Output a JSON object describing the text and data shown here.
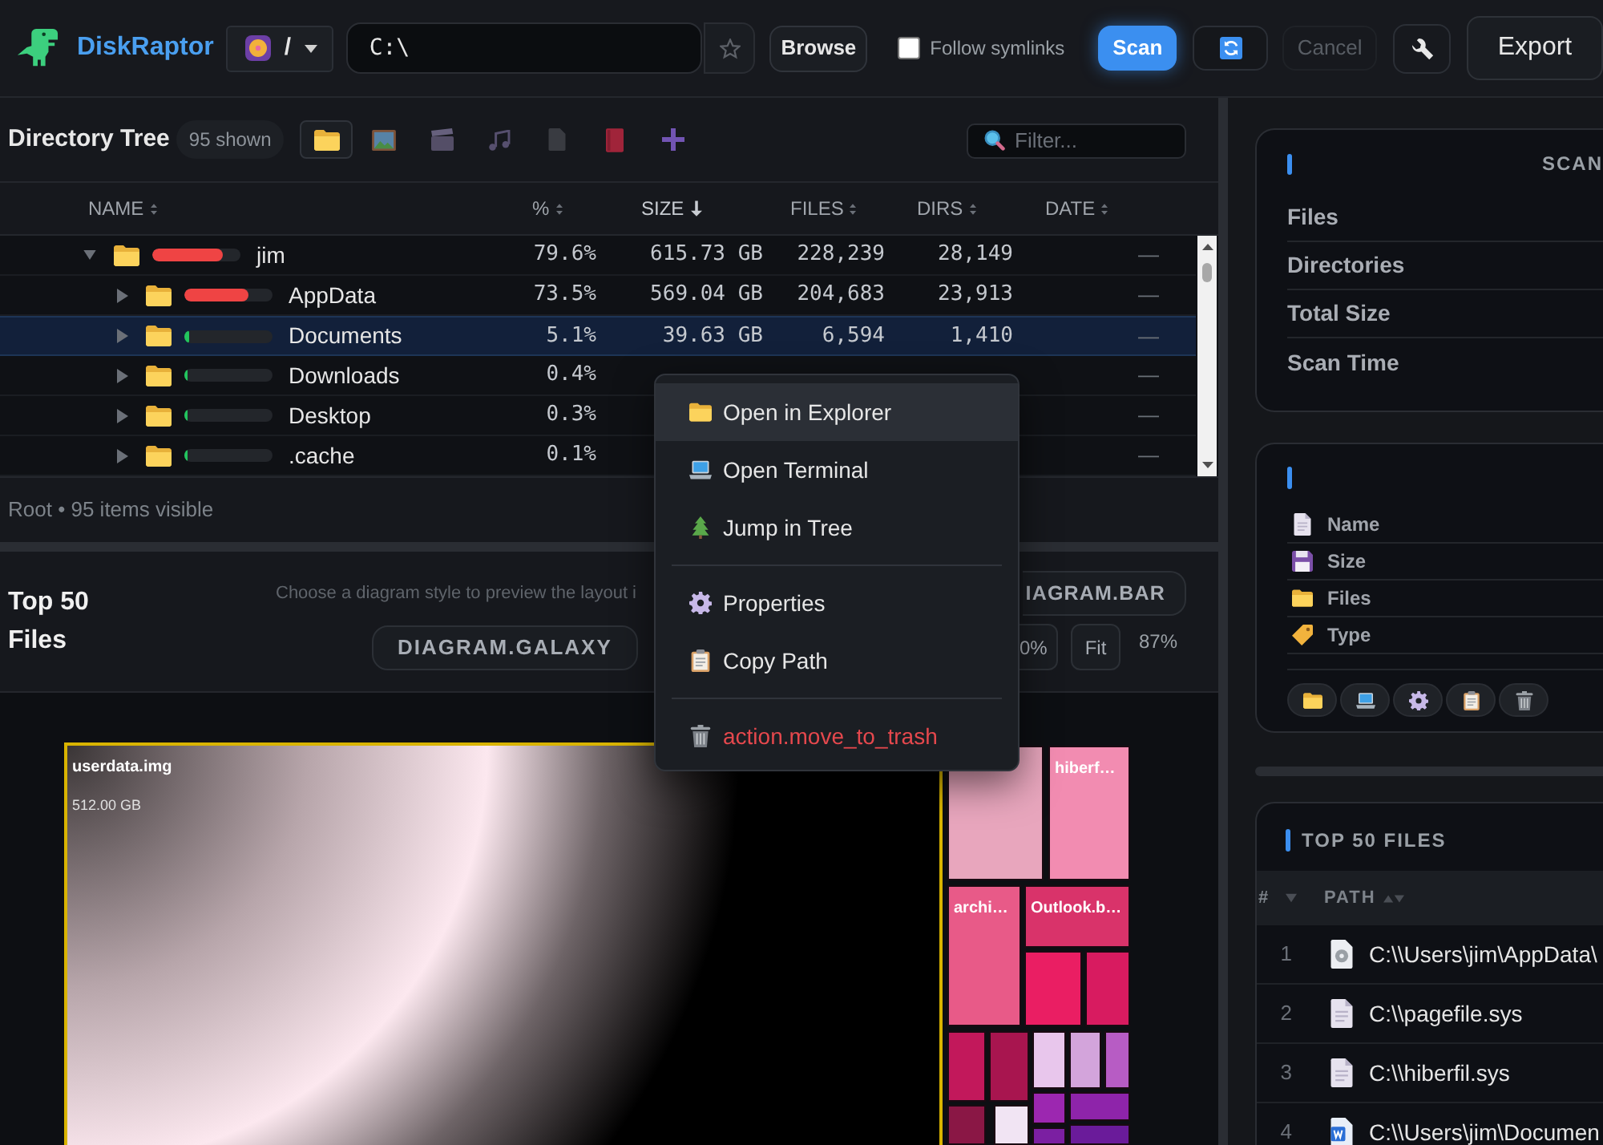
{
  "app": {
    "name": "DiskRaptor"
  },
  "toolbar": {
    "drive": {
      "label": "/"
    },
    "path": {
      "value": "C:\\"
    },
    "browse": {
      "label": "Browse"
    },
    "follow_symlinks": {
      "label": "Follow symlinks",
      "checked": false
    },
    "scan": {
      "label": "Scan"
    },
    "cancel": {
      "label": "Cancel",
      "disabled": true
    },
    "export": {
      "label": "Export"
    }
  },
  "directory_tree": {
    "title": "Directory Tree",
    "badge": "95 shown",
    "type_filters": [
      {
        "kind": "folder",
        "selected": true
      },
      {
        "kind": "image",
        "selected": false
      },
      {
        "kind": "video",
        "selected": false
      },
      {
        "kind": "music",
        "selected": false
      },
      {
        "kind": "document",
        "selected": false
      },
      {
        "kind": "book",
        "selected": false
      },
      {
        "kind": "other",
        "selected": false
      }
    ],
    "filter": {
      "placeholder": "Filter..."
    },
    "columns": [
      {
        "label": "NAME",
        "sorted": false
      },
      {
        "label": "%",
        "sorted": false
      },
      {
        "label": "SIZE",
        "sorted": true
      },
      {
        "label": "FILES",
        "sorted": false
      },
      {
        "label": "DIRS",
        "sorted": false
      },
      {
        "label": "DATE",
        "sorted": false
      }
    ],
    "rows": [
      {
        "name": "jim",
        "expanded": true,
        "selected": false,
        "level": 0.796,
        "color": "#ef4444",
        "percent": "79.6%",
        "size": "615.73 GB",
        "files": "228,239",
        "dirs": "28,149",
        "date": "—",
        "children": [
          {
            "name": "AppData",
            "expanded": false,
            "selected": false,
            "level": 0.735,
            "color": "#ef4444",
            "percent": "73.5%",
            "size": "569.04 GB",
            "files": "204,683",
            "dirs": "23,913",
            "date": "—"
          },
          {
            "name": "Documents",
            "expanded": false,
            "selected": true,
            "level": 0.051,
            "color": "#22c55e",
            "percent": "5.1%",
            "size": "39.63 GB",
            "files": "6,594",
            "dirs": "1,410",
            "date": "—"
          },
          {
            "name": "Downloads",
            "expanded": false,
            "selected": false,
            "level": 0.004,
            "color": "#22c55e",
            "percent": "0.4%",
            "date": "—"
          },
          {
            "name": "Desktop",
            "expanded": false,
            "selected": false,
            "level": 0.003,
            "color": "#22c55e",
            "percent": "0.3%",
            "date": "—"
          },
          {
            "name": ".cache",
            "expanded": false,
            "selected": false,
            "level": 0.001,
            "color": "#22c55e",
            "percent": "0.1%",
            "date": "—"
          }
        ]
      }
    ],
    "status": "Root • 95 items visible"
  },
  "top_files_view": {
    "title": "Top 50 Files",
    "hint": "Choose a diagram style to preview the layout i",
    "diagram_styles": [
      "IAGRAM.BAR",
      "DIAGRAM.GALAXY"
    ],
    "zoom_buttons": [
      "0%",
      "Fit"
    ],
    "zoom_level": "87%",
    "treemap": {
      "tiles": [
        {
          "kind": "preview",
          "label": "userdata.img",
          "size": "512.00 GB",
          "selected": true
        },
        {
          "kind": "file",
          "color": "#e8a6bd",
          "selected": false
        },
        {
          "kind": "file",
          "label": "hiberf…",
          "color": "#f28cb1",
          "selected": false
        },
        {
          "kind": "file",
          "label": "archi…",
          "color": "#e85a88",
          "selected": false
        },
        {
          "kind": "file",
          "label": "Outlook.b…",
          "color": "#d9336a",
          "selected": false
        },
        {
          "kind": "file",
          "color": "#ea1e63",
          "selected": false
        },
        {
          "kind": "file",
          "color": "#d81b60",
          "selected": false
        },
        {
          "kind": "file",
          "color": "#c2185b",
          "selected": false
        },
        {
          "kind": "file",
          "color": "#a8154f",
          "selected": false
        },
        {
          "kind": "file",
          "color": "#e8c6ec",
          "selected": false
        },
        {
          "kind": "file",
          "color": "#d3a4db",
          "selected": false
        },
        {
          "kind": "file",
          "color": "#b75cc4",
          "selected": false
        },
        {
          "kind": "file",
          "color": "#8a1745",
          "selected": false
        },
        {
          "kind": "file",
          "color": "#f1e4f3",
          "selected": false
        },
        {
          "kind": "file",
          "color": "#9c27b0",
          "selected": false
        },
        {
          "kind": "file",
          "color": "#8e24aa",
          "selected": false
        },
        {
          "kind": "file",
          "color": "#7b1fa2",
          "selected": false
        },
        {
          "kind": "file",
          "color": "#6a1b9a",
          "selected": false
        }
      ]
    }
  },
  "context_menu": {
    "items": [
      {
        "kind": "open",
        "label": "Open in Explorer",
        "selected": true
      },
      {
        "kind": "terminal",
        "label": "Open Terminal",
        "selected": false
      },
      {
        "kind": "jump",
        "label": "Jump in Tree",
        "selected": false
      },
      {
        "kind": "separator"
      },
      {
        "kind": "properties",
        "label": "Properties",
        "selected": false
      },
      {
        "kind": "copy",
        "label": "Copy Path",
        "selected": false
      },
      {
        "kind": "separator"
      },
      {
        "kind": "trash",
        "label": "action.move_to_trash",
        "selected": false
      }
    ]
  },
  "scan_summary": {
    "title": "SCAN",
    "rows": [
      "Files",
      "Directories",
      "Total Size",
      "Scan Time"
    ]
  },
  "details": {
    "fields": [
      {
        "kind": "name",
        "label": "Name"
      },
      {
        "kind": "size",
        "label": "Size"
      },
      {
        "kind": "files",
        "label": "Files"
      },
      {
        "kind": "type",
        "label": "Type"
      }
    ],
    "actions": [
      {
        "kind": "open"
      },
      {
        "kind": "terminal"
      },
      {
        "kind": "properties"
      },
      {
        "kind": "copy"
      },
      {
        "kind": "trash"
      }
    ]
  },
  "top_files": {
    "title": "TOP 50 FILES",
    "columns": [
      {
        "label": "#",
        "sorted": true
      },
      {
        "label": "PATH",
        "sorted": false
      }
    ],
    "rows": [
      {
        "rank": "1",
        "kind": "disk-image",
        "path": "C:\\\\Users\\jim\\AppData\\"
      },
      {
        "rank": "2",
        "kind": "system",
        "path": "C:\\\\pagefile.sys"
      },
      {
        "rank": "3",
        "kind": "system",
        "path": "C:\\\\hiberfil.sys"
      },
      {
        "rank": "4",
        "kind": "document",
        "path": "C:\\\\Users\\jim\\Documen"
      }
    ]
  }
}
